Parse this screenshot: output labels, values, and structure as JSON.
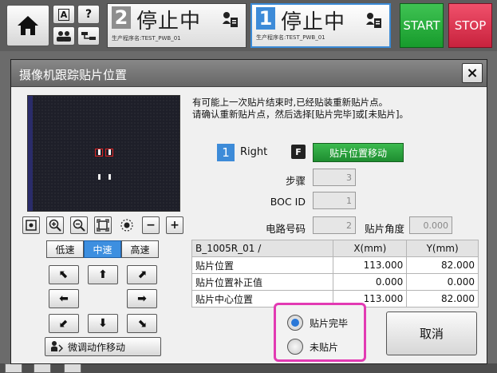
{
  "topbar": {
    "status_left": {
      "number": "2",
      "text": "停止中",
      "program": "生产程序名:TEST_PWB_01"
    },
    "status_right": {
      "number": "1",
      "text": "停止中",
      "program": "生产程序名:TEST_PWB_01"
    },
    "start_label": "START",
    "stop_label": "STOP",
    "small_a": "A",
    "small_q": "?"
  },
  "dialog": {
    "title": "摄像机跟踪贴片位置",
    "close": "×",
    "message_line1": "有可能上一次贴片结束时,已经贴装重新贴片点。",
    "message_line2": "请确认重新贴片点，然后选择[贴片完毕]或[未贴片]。",
    "head_number": "1",
    "head_name": "Right",
    "f_badge": "F",
    "move_button": "贴片位置移动",
    "fields": {
      "step_label": "步骤",
      "step_value": "3",
      "boc_label": "BOC ID",
      "boc_value": "1",
      "circuit_label": "电路号码",
      "circuit_value": "2",
      "angle_label": "贴片角度",
      "angle_value": "0.000"
    },
    "speed": {
      "low": "低速",
      "mid": "中速",
      "high": "高速"
    },
    "jog_label": "微调动作移动",
    "table": {
      "headers": [
        "B_1005R_01 /",
        "X(mm)",
        "Y(mm)"
      ],
      "rows": [
        [
          "贴片位置",
          "113.000",
          "82.000"
        ],
        [
          "贴片位置补正值",
          "0.000",
          "0.000"
        ],
        [
          "贴片中心位置",
          "113.000",
          "82.000"
        ]
      ]
    },
    "radio_done": "贴片完毕",
    "radio_not": "未贴片",
    "cancel": "取消",
    "tool_minus": "−",
    "tool_plus": "+",
    "arrows": {
      "nw": "⬉",
      "n": "⬆",
      "ne": "⬈",
      "w": "⬅",
      "e": "➡",
      "sw": "⬋",
      "s": "⬇",
      "se": "⬊"
    }
  },
  "colors": {
    "accent_blue": "#3d8bd8",
    "start_green": "#1e8d30",
    "stop_red": "#c8223d",
    "highlight_pink": "#e23ab3"
  }
}
